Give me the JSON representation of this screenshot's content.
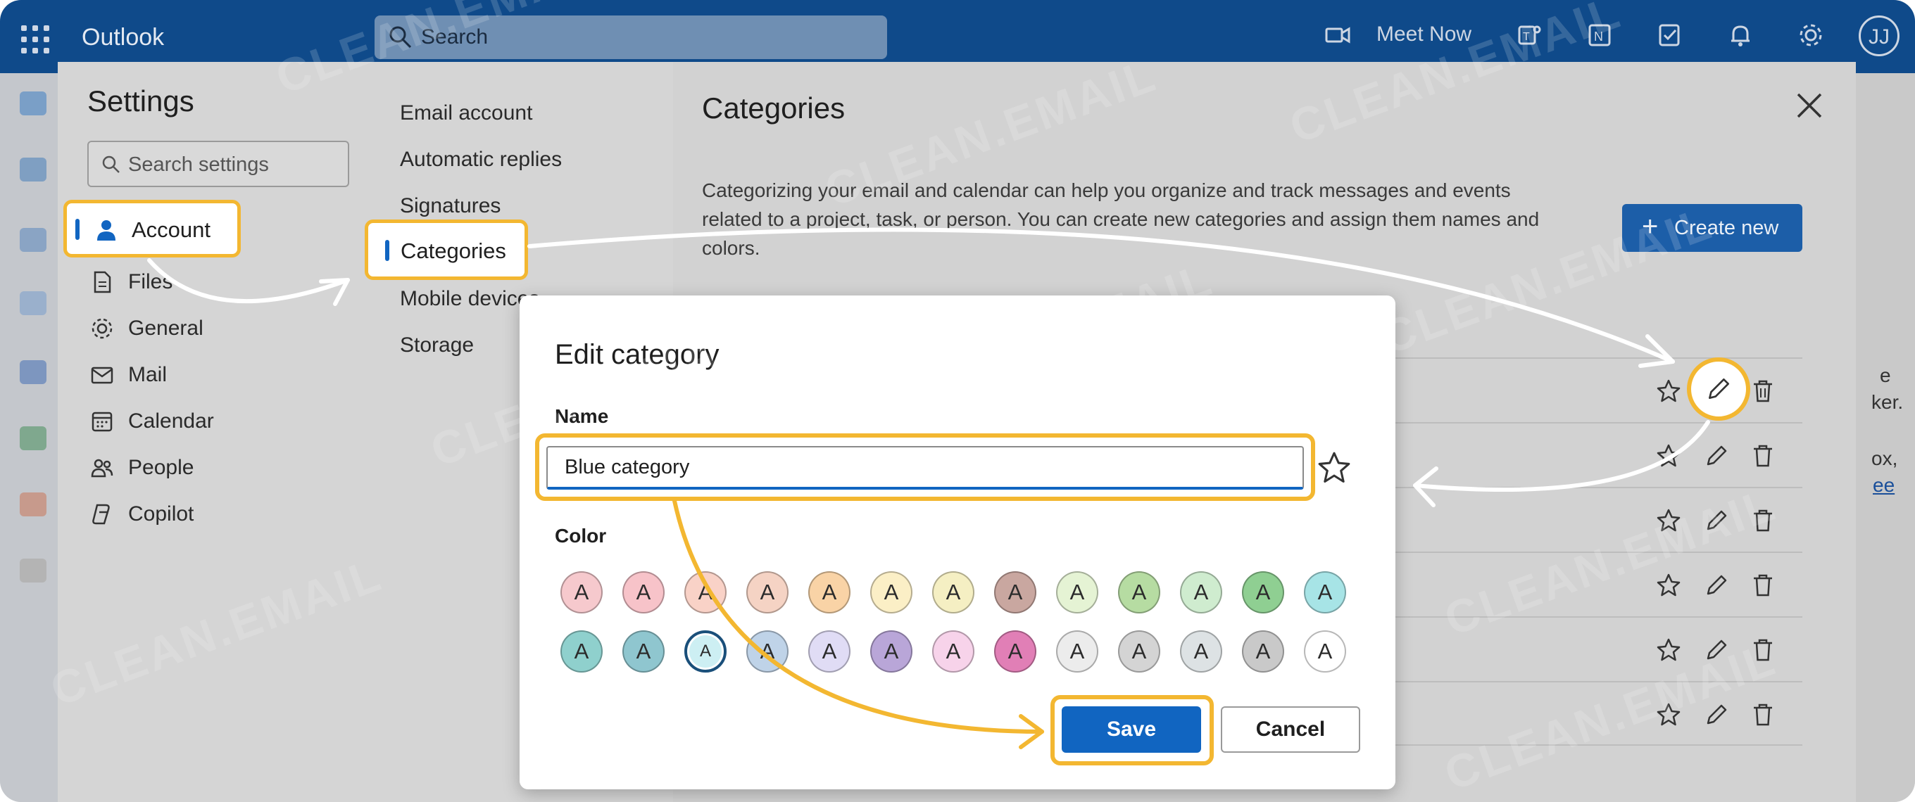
{
  "topbar": {
    "app_title": "Outlook",
    "search_placeholder": "Search",
    "meet_now": "Meet Now",
    "avatar_initials": "JJ"
  },
  "settings": {
    "title": "Settings",
    "search_placeholder": "Search settings",
    "nav": [
      {
        "label": "Account",
        "icon": "person-icon"
      },
      {
        "label": "Files",
        "icon": "file-icon"
      },
      {
        "label": "General",
        "icon": "gear-icon"
      },
      {
        "label": "Mail",
        "icon": "mail-icon"
      },
      {
        "label": "Calendar",
        "icon": "calendar-icon"
      },
      {
        "label": "People",
        "icon": "people-icon"
      },
      {
        "label": "Copilot",
        "icon": "copilot-icon"
      }
    ],
    "subnav": [
      "Email account",
      "Automatic replies",
      "Signatures",
      "Categories",
      "Mobile devices",
      "Storage"
    ]
  },
  "categories": {
    "title": "Categories",
    "description": "Categorizing your email and calendar can help you organize and track messages and events related to a project, task, or person. You can create new categories and assign them names and colors.",
    "create_new": "Create new"
  },
  "peek": {
    "l1": "e",
    "l2": "ker.",
    "l3": "ox,",
    "l4": "ee"
  },
  "dialog": {
    "title": "Edit category",
    "name_label": "Name",
    "name_value": "Blue category",
    "color_label": "Color",
    "swatch_letter": "A",
    "save": "Save",
    "cancel": "Cancel",
    "selected_color": "#cdeff3",
    "swatch_colors": [
      "#f6c9cd",
      "#f7c3c9",
      "#f9d2c7",
      "#f5d3c4",
      "#f9d3a6",
      "#fbefc6",
      "#f5efc3",
      "#c9a7a0",
      "#e5f3d4",
      "#b6dca2",
      "#cfeccf",
      "#8fcf92",
      "#a7e4e6",
      "#8fd0cd",
      "#8fc6cf",
      "#cdeff3",
      "#bfd3e8",
      "#e0dcf5",
      "#b9a6d8",
      "#f7d3ea",
      "#e17fb6",
      "#ececec",
      "#d4d4d4",
      "#dde2e4",
      "#c9c9c9",
      "#ffffff"
    ]
  },
  "watermark": "CLEAN.EMAIL",
  "colors": {
    "accent": "#1165c1",
    "highlight": "#f3b731",
    "topbar": "#0f4a8a"
  }
}
